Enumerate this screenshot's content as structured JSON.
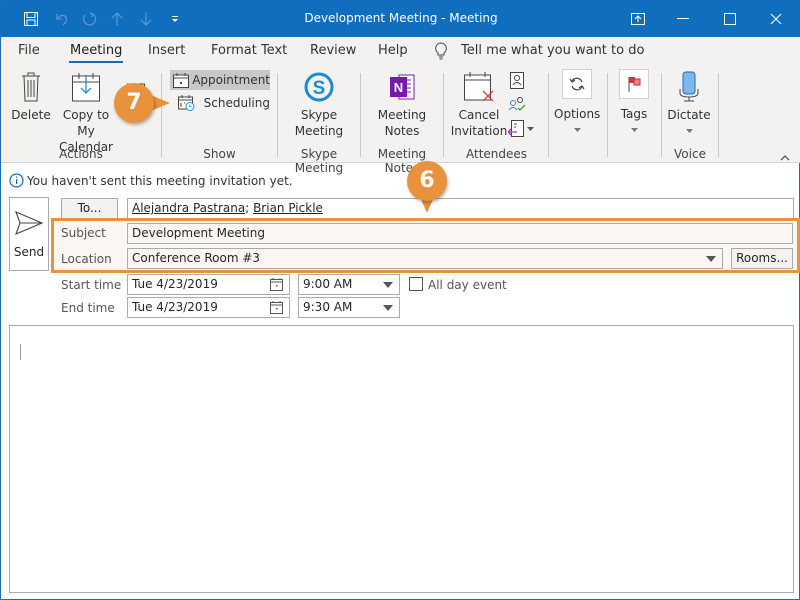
{
  "window": {
    "title": "Development Meeting - Meeting"
  },
  "quick_access": [
    "save-icon",
    "undo-icon",
    "redo-icon",
    "up-icon",
    "down-icon",
    "customize-icon"
  ],
  "tabs": [
    {
      "label": "File"
    },
    {
      "label": "Meeting",
      "active": true
    },
    {
      "label": "Insert"
    },
    {
      "label": "Format Text"
    },
    {
      "label": "Review"
    },
    {
      "label": "Help"
    }
  ],
  "tell_me": "Tell me what you want to do",
  "ribbon": {
    "delete": "Delete",
    "copy_line1": "Copy to My",
    "copy_line2": "Calendar",
    "actions_group": "Actions",
    "appointment": "Appointment",
    "scheduling": "Scheduling",
    "show_group": "Show",
    "skype_line1": "Skype",
    "skype_line2": "Meeting",
    "skype_group": "Skype Meeting",
    "notes_line1": "Meeting",
    "notes_line2": "Notes",
    "notes_group": "Meeting Notes",
    "cancel_line1": "Cancel",
    "cancel_line2": "Invitation",
    "attendees_group": "Attendees",
    "options": "Options",
    "tags": "Tags",
    "dictate": "Dictate",
    "voice_group": "Voice"
  },
  "info_bar": "You haven't sent this meeting invitation yet.",
  "form": {
    "send_label": "Send",
    "to_button": "To...",
    "recipients": [
      "Alejandra Pastrana",
      "Brian Pickle"
    ],
    "subject_label": "Subject",
    "subject_value": "Development Meeting",
    "location_label": "Location",
    "location_value": "Conference Room #3",
    "rooms_button": "Rooms...",
    "start_label": "Start time",
    "start_date": "Tue 4/23/2019",
    "start_time": "9:00 AM",
    "all_day_label": "All day event",
    "all_day_checked": false,
    "end_label": "End time",
    "end_date": "Tue 4/23/2019",
    "end_time": "9:30 AM"
  },
  "callouts": {
    "six": "6",
    "seven": "7",
    "color": "#e8923b"
  },
  "colors": {
    "accent": "#106ebe",
    "highlight": "#e8923b"
  }
}
